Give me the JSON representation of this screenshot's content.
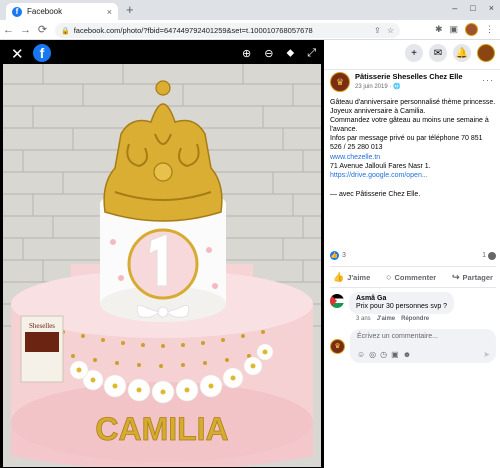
{
  "browser": {
    "tab_title": "Facebook",
    "tab_favicon": "f",
    "tab_close": "×",
    "new_tab": "+",
    "win_minimize": "–",
    "win_maximize": "□",
    "win_close": "×",
    "nav_back": "←",
    "nav_forward": "→",
    "nav_reload": "⟳",
    "url": "facebook.com/photo/?fbid=647449792401259&set=t.100010768057678",
    "lock_glyph": "🔒",
    "share_glyph": "⇪",
    "star_glyph": "☆",
    "puzzle_glyph": "✱",
    "sidepanel_glyph": "▣",
    "menu_glyph": "⋮"
  },
  "viewer": {
    "close_glyph": "✕",
    "logo": "f",
    "zoom_in_glyph": "⊕",
    "zoom_out_glyph": "⊖",
    "tag_glyph": "⬥",
    "fullscreen_glyph": "⤢",
    "cake_name": "CAMILIA",
    "box_label": "Sheselles"
  },
  "sidebar": {
    "plus_glyph": "+",
    "messenger_glyph": "✉",
    "bell_glyph": "🔔",
    "post": {
      "page_name": "Pâtisserie Sheselles Chez Elle",
      "date": "23 juin 2019 · 🌐",
      "more": "···",
      "body": "Gâteau d'anniversaire personnalisé thème princesse. Joyeux anniversaire à Camilia.\nCommandez votre gâteau au moins une semaine à l'avance.\nInfos par message privé ou par téléphone 70 851 526 / 25 280 013",
      "link1": "www.chezelle.tn",
      "address": "71 Avenue Jallouli Fares Nasr 1.",
      "link2": "https://drive.google.com/open...",
      "tagline": "— avec Pâtisserie Chez Elle."
    },
    "reactions": {
      "like_count": "3",
      "comment_count": "1"
    },
    "actions": {
      "like": "J'aime",
      "comment": "Commenter",
      "share": "Partager"
    },
    "comment": {
      "author": "Asmâ Ga",
      "text": "Prix pour 30 personnes svp ?",
      "age": "3 ans",
      "like": "J'aime",
      "reply": "Répondre"
    },
    "composer": {
      "placeholder": "Écrivez un commentaire...",
      "icons": [
        "☺",
        "◎",
        "◷",
        "▣",
        "☻"
      ],
      "send_glyph": "➤"
    }
  }
}
